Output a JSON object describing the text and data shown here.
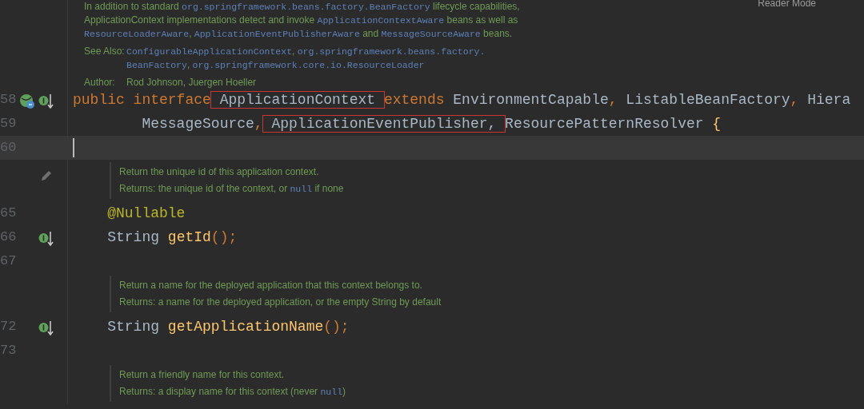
{
  "reader_mode": {
    "label": "Reader Mode"
  },
  "class_doc": {
    "paragraphs": [
      {
        "lines": [
          [
            {
              "text": "In addition to standard ",
              "kind": "text"
            },
            {
              "text": "org.springframework.beans.factory.BeanFactory",
              "kind": "code"
            },
            {
              "text": " lifecycle capabilities,",
              "kind": "text"
            }
          ],
          [
            {
              "text": "ApplicationContext implementations detect and invoke ",
              "kind": "text"
            },
            {
              "text": "ApplicationContextAware",
              "kind": "code"
            },
            {
              "text": " beans as well as",
              "kind": "text"
            }
          ],
          [
            {
              "text": "ResourceLoaderAware",
              "kind": "code"
            },
            {
              "text": ", ",
              "kind": "text"
            },
            {
              "text": "ApplicationEventPublisherAware",
              "kind": "code"
            },
            {
              "text": " and ",
              "kind": "text"
            },
            {
              "text": "MessageSourceAware",
              "kind": "code"
            },
            {
              "text": " beans.",
              "kind": "text"
            }
          ]
        ]
      },
      {
        "label": "See Also:",
        "lines": [
          [
            {
              "text": "ConfigurableApplicationContext",
              "kind": "code"
            },
            {
              "text": ", ",
              "kind": "text"
            },
            {
              "text": "org.springframework.beans.factory.",
              "kind": "code"
            }
          ],
          [
            {
              "text": "BeanFactory",
              "kind": "code"
            },
            {
              "text": ", ",
              "kind": "text"
            },
            {
              "text": "org.springframework.core.io.ResourceLoader",
              "kind": "code"
            }
          ]
        ]
      },
      {
        "label": "Author:",
        "lines": [
          [
            {
              "text": "Rod Johnson, Juergen Hoeller",
              "kind": "text"
            }
          ]
        ]
      }
    ]
  },
  "rows": [
    {
      "kind": "code",
      "number": "58",
      "current": false,
      "icons": [
        {
          "kind": "bean"
        },
        {
          "kind": "implemented"
        }
      ],
      "tokens": [
        {
          "text": "public interface",
          "kind": "keyword",
          "highlighted": false
        },
        {
          "text": " ApplicationContext ",
          "kind": "plain",
          "highlighted": true
        },
        {
          "text": "extends",
          "kind": "keyword",
          "highlighted": false
        },
        {
          "text": " EnvironmentCapable",
          "kind": "plain",
          "highlighted": false
        },
        {
          "text": ", ",
          "kind": "keyword",
          "highlighted": false
        },
        {
          "text": "ListableBeanFactory",
          "kind": "plain",
          "highlighted": false
        },
        {
          "text": ", ",
          "kind": "keyword",
          "highlighted": false
        },
        {
          "text": "Hiera",
          "kind": "plain",
          "highlighted": false
        }
      ]
    },
    {
      "kind": "code",
      "number": "59",
      "current": false,
      "icons": [],
      "tokens": [
        {
          "text": "        MessageSource",
          "kind": "plain",
          "highlighted": false
        },
        {
          "text": ",",
          "kind": "keyword",
          "highlighted": false
        },
        {
          "text": " ApplicationEventPublisher, ",
          "kind": "plain",
          "highlighted": true
        },
        {
          "text": "ResourcePatternResolver ",
          "kind": "plain",
          "highlighted": false
        },
        {
          "text": "{",
          "kind": "method",
          "highlighted": false
        }
      ]
    },
    {
      "kind": "code",
      "number": "60",
      "current": true,
      "icons": [],
      "tokens": []
    },
    {
      "kind": "doc",
      "editable": true,
      "lines": [
        [
          {
            "text": "Return the unique id of this application context.",
            "kind": "text"
          }
        ],
        [
          {
            "text": "Returns: the unique id of the context, or ",
            "kind": "text"
          },
          {
            "text": "null",
            "kind": "code"
          },
          {
            "text": " if none",
            "kind": "text"
          }
        ]
      ]
    },
    {
      "kind": "code",
      "number": "65",
      "current": false,
      "icons": [],
      "tokens": [
        {
          "text": "    @Nullable",
          "kind": "annotation",
          "highlighted": false
        }
      ]
    },
    {
      "kind": "code",
      "number": "66",
      "current": false,
      "icons": [
        {
          "kind": "implemented"
        }
      ],
      "tokens": [
        {
          "text": "    String ",
          "kind": "plain",
          "highlighted": false
        },
        {
          "text": "getId",
          "kind": "method",
          "highlighted": false
        },
        {
          "text": "();",
          "kind": "keyword",
          "highlighted": false
        }
      ]
    },
    {
      "kind": "code",
      "number": "67",
      "current": false,
      "icons": [],
      "tokens": []
    },
    {
      "kind": "doc",
      "editable": false,
      "lines": [
        [
          {
            "text": "Return a name for the deployed application that this context belongs to.",
            "kind": "text"
          }
        ],
        [
          {
            "text": "Returns: a name for the deployed application, or the empty String by default",
            "kind": "text"
          }
        ]
      ]
    },
    {
      "kind": "code",
      "number": "72",
      "current": false,
      "icons": [
        {
          "kind": "implemented"
        }
      ],
      "tokens": [
        {
          "text": "    String ",
          "kind": "plain",
          "highlighted": false
        },
        {
          "text": "getApplicationName",
          "kind": "method",
          "highlighted": false
        },
        {
          "text": "();",
          "kind": "keyword",
          "highlighted": false
        }
      ]
    },
    {
      "kind": "code",
      "number": "73",
      "current": false,
      "icons": [],
      "tokens": []
    },
    {
      "kind": "doc",
      "editable": false,
      "lines": [
        [
          {
            "text": "Return a friendly name for this context.",
            "kind": "text"
          }
        ],
        [
          {
            "text": "Returns: a display name for this context (never ",
            "kind": "text"
          },
          {
            "text": "null",
            "kind": "code"
          },
          {
            "text": ")",
            "kind": "text"
          }
        ]
      ]
    }
  ]
}
